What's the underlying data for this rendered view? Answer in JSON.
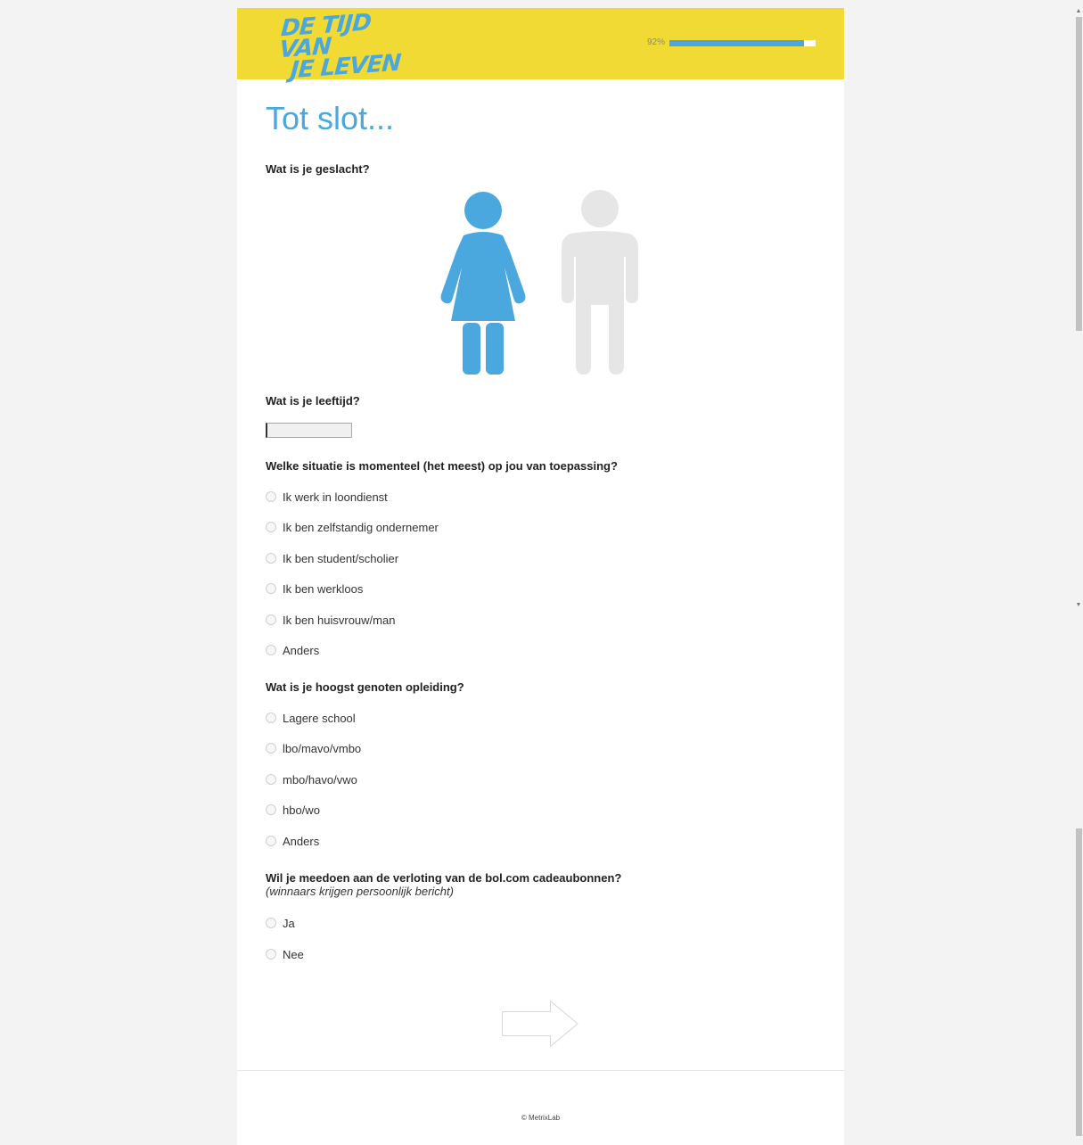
{
  "header": {
    "logo_line1": "DE TIJD VAN",
    "logo_line2": "JE LEVEN",
    "progress_label": "92%",
    "progress_fraction": 0.92,
    "brand_yellow": "#f2da34",
    "accent_blue": "#4aa8df"
  },
  "title": "Tot slot...",
  "gender": {
    "question": "Wat is je geslacht?",
    "options": [
      {
        "icon": "female-figure-icon",
        "selected": true,
        "color": "#4aa8df"
      },
      {
        "icon": "male-figure-icon",
        "selected": false,
        "color": "#e6e6e6"
      }
    ]
  },
  "age": {
    "question": "Wat is je leeftijd?",
    "value": ""
  },
  "situation": {
    "question": "Welke situatie is momenteel (het meest) op jou van toepassing?",
    "options": [
      "Ik werk in loondienst",
      "Ik ben zelfstandig ondernemer",
      "Ik ben student/scholier",
      "Ik ben werkloos",
      "Ik ben huisvrouw/man",
      "Anders"
    ]
  },
  "education": {
    "question": "Wat is je hoogst genoten opleiding?",
    "options": [
      "Lagere school",
      "lbo/mavo/vmbo",
      "mbo/havo/vwo",
      "hbo/wo",
      "Anders"
    ]
  },
  "lottery": {
    "question": "Wil je meedoen aan de verloting van de bol.com cadeaubonnen?",
    "subtext": "(winnaars krijgen persoonlijk bericht)",
    "options": [
      "Ja",
      "Nee"
    ]
  },
  "footer": {
    "copyright": "© MetrixLab"
  }
}
